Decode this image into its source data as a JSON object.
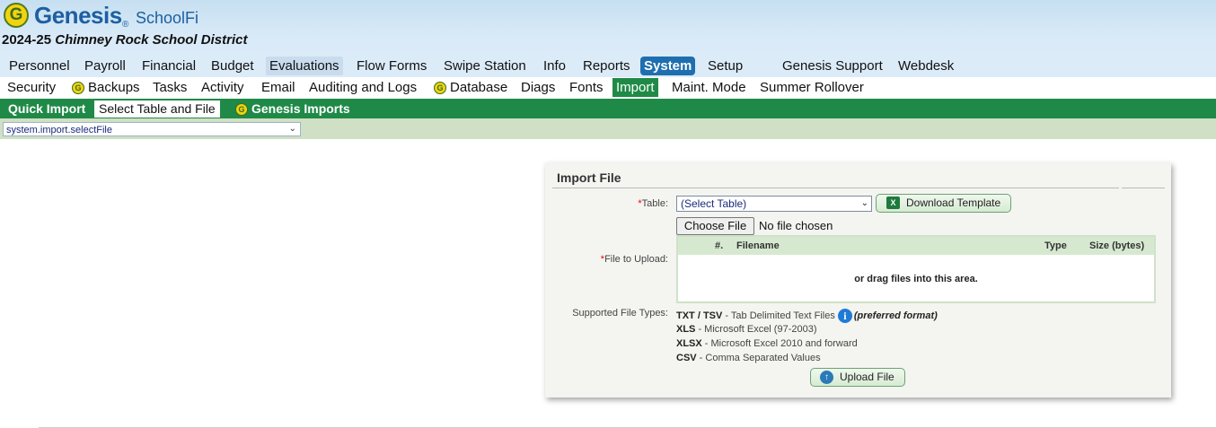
{
  "header": {
    "brand": "Genesis",
    "brand_reg": "®",
    "product": "SchoolFi",
    "year": "2024-25",
    "district": "Chimney Rock School District"
  },
  "main_nav": [
    {
      "label": "Personnel"
    },
    {
      "label": "Payroll"
    },
    {
      "label": "Financial"
    },
    {
      "label": "Budget"
    },
    {
      "label": "Evaluations"
    },
    {
      "label": "Flow Forms"
    },
    {
      "label": "Swipe Station"
    },
    {
      "label": "Info"
    },
    {
      "label": "Reports"
    },
    {
      "label": "System",
      "selected": true
    },
    {
      "label": "Setup"
    },
    {
      "label": "Genesis Support"
    },
    {
      "label": "Webdesk"
    }
  ],
  "sub_nav": [
    {
      "label": "Security"
    },
    {
      "label": "Backups",
      "icon": "genesis-g-icon"
    },
    {
      "label": "Tasks"
    },
    {
      "label": "Activity"
    },
    {
      "label": "Email"
    },
    {
      "label": "Auditing and Logs"
    },
    {
      "label": "Database",
      "icon": "genesis-g-icon"
    },
    {
      "label": "Diags"
    },
    {
      "label": "Fonts"
    },
    {
      "label": "Import",
      "selected": true
    },
    {
      "label": "Maint. Mode"
    },
    {
      "label": "Summer Rollover"
    }
  ],
  "tabs": [
    {
      "label": "Quick Import"
    },
    {
      "label": "Select Table and File",
      "selected": true
    },
    {
      "label": "Genesis Imports",
      "icon": "genesis-g-icon"
    }
  ],
  "page_selector": {
    "value": "system.import.selectFile"
  },
  "import_panel": {
    "title": "Import File",
    "required_mark": "*",
    "table_label": "Table:",
    "table_value": "(Select Table)",
    "download_label": "Download Template",
    "download_icon": "excel-icon",
    "choose_file_label": "Choose File",
    "no_file_text": "No file chosen",
    "file_label": "File to Upload:",
    "drop_columns": [
      "#.",
      "Filename",
      "Type",
      "Size (bytes)"
    ],
    "drop_message": "or drag files into this area.",
    "supported_label": "Supported File Types:",
    "file_types": [
      {
        "code": "TXT / TSV",
        "desc": " - Tab Delimited Text Files"
      },
      {
        "code": "XLS",
        "desc": " - Microsoft Excel (97-2003)"
      },
      {
        "code": "XLSX",
        "desc": " - Microsoft Excel 2010 and forward"
      },
      {
        "code": "CSV",
        "desc": " - Comma Separated Values"
      }
    ],
    "preferred_note": "(preferred format)",
    "upload_label": "Upload File"
  },
  "colors": {
    "header_bg": "#d7e9f7",
    "nav_selected": "#1f6fb0",
    "green_bar": "#1f8a47",
    "selector_bar": "#cfe0c4"
  }
}
